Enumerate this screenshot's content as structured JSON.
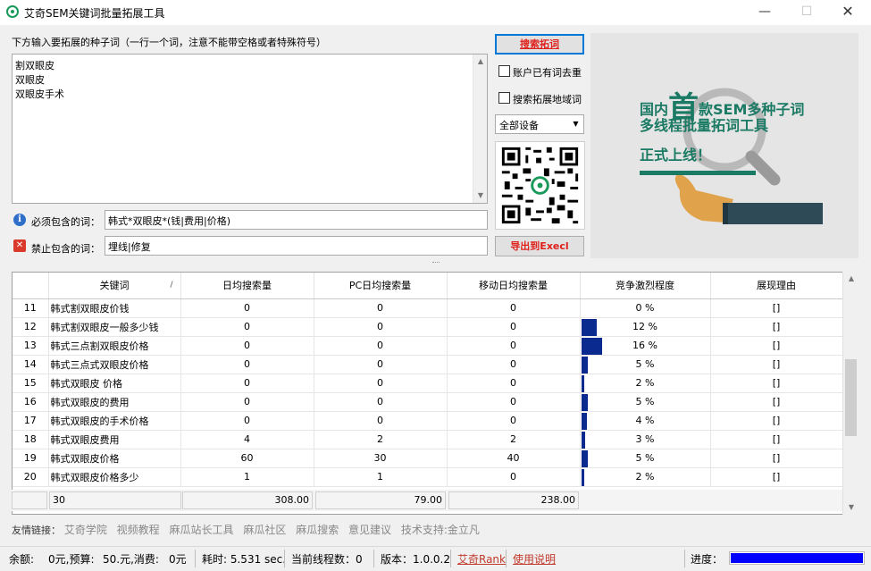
{
  "window": {
    "title": "艾奇SEM关键词批量拓展工具",
    "minimize_glyph": "—",
    "maximize_glyph": "☐",
    "close_glyph": "✕"
  },
  "seed": {
    "label": "下方输入要拓展的种子词（一行一个词，注意不能带空格或者特殊符号）",
    "lines": [
      "割双眼皮",
      "双眼皮",
      "双眼皮手术"
    ]
  },
  "filters": {
    "include_label": "必须包含的词：",
    "include_value": "韩式*双眼皮*(钱|费用|价格)",
    "exclude_label": "禁止包含的词：",
    "exclude_value": "埋线|修复"
  },
  "controls": {
    "search_button": "搜索拓词",
    "dedupe_label": "账户已有词去重",
    "region_label": "搜索拓展地域词",
    "device_select": "全部设备",
    "export_button": "导出到Execl"
  },
  "banner": {
    "line1_pre": "国内",
    "line1_big": "首",
    "line1_post": "款SEM多种子词",
    "line2": "多线程批量拓词工具",
    "line3": "正式上线！",
    "accent": "#1b7a64"
  },
  "table": {
    "headers": [
      "关键词",
      "日均搜索量",
      "PC日均搜索量",
      "移动日均搜索量",
      "竞争激烈程度",
      "展现理由"
    ],
    "sort_glyph": "/",
    "rows": [
      {
        "idx": "11",
        "keyword": "韩式割双眼皮价钱",
        "daily": "0",
        "pc": "0",
        "mobile": "0",
        "comp": 0,
        "comp_text": "0 %",
        "reason": "[]"
      },
      {
        "idx": "12",
        "keyword": "韩式割双眼皮一般多少钱",
        "daily": "0",
        "pc": "0",
        "mobile": "0",
        "comp": 12,
        "comp_text": "12 %",
        "reason": "[]"
      },
      {
        "idx": "13",
        "keyword": "韩式三点割双眼皮价格",
        "daily": "0",
        "pc": "0",
        "mobile": "0",
        "comp": 16,
        "comp_text": "16 %",
        "reason": "[]"
      },
      {
        "idx": "14",
        "keyword": "韩式三点式双眼皮价格",
        "daily": "0",
        "pc": "0",
        "mobile": "0",
        "comp": 5,
        "comp_text": "5 %",
        "reason": "[]"
      },
      {
        "idx": "15",
        "keyword": "韩式双眼皮 价格",
        "daily": "0",
        "pc": "0",
        "mobile": "0",
        "comp": 2,
        "comp_text": "2 %",
        "reason": "[]"
      },
      {
        "idx": "16",
        "keyword": "韩式双眼皮的费用",
        "daily": "0",
        "pc": "0",
        "mobile": "0",
        "comp": 5,
        "comp_text": "5 %",
        "reason": "[]"
      },
      {
        "idx": "17",
        "keyword": "韩式双眼皮的手术价格",
        "daily": "0",
        "pc": "0",
        "mobile": "0",
        "comp": 4,
        "comp_text": "4 %",
        "reason": "[]"
      },
      {
        "idx": "18",
        "keyword": "韩式双眼皮费用",
        "daily": "4",
        "pc": "2",
        "mobile": "2",
        "comp": 3,
        "comp_text": "3 %",
        "reason": "[]"
      },
      {
        "idx": "19",
        "keyword": "韩式双眼皮价格",
        "daily": "60",
        "pc": "30",
        "mobile": "40",
        "comp": 5,
        "comp_text": "5 %",
        "reason": "[]"
      },
      {
        "idx": "20",
        "keyword": "韩式双眼皮价格多少",
        "daily": "1",
        "pc": "1",
        "mobile": "0",
        "comp": 2,
        "comp_text": "2 %",
        "reason": "[]"
      }
    ],
    "footer": {
      "count": "30",
      "daily": "308.00",
      "pc": "79.00",
      "mobile": "238.00"
    },
    "bar_color": "#0a2a8f"
  },
  "links": {
    "label": "友情链接：",
    "items": [
      "艾奇学院",
      "视频教程",
      "麻瓜站长工具",
      "麻瓜社区",
      "麻瓜搜索",
      "意见建议",
      "技术支持:金立凡"
    ]
  },
  "status": {
    "balance": "余额:",
    "balance_val": "0元,预算:",
    "budget_val": "50.元,消费:",
    "spend_val": "0元",
    "time": "耗时: 5.531 sec.",
    "threads": "当前线程数：0",
    "version": "版本：1.0.0.2",
    "link_rank": "艾奇Rank",
    "link_help": "使用说明",
    "progress_label": "进度：",
    "progress_value": 1.0,
    "progress_color": "#0000ff"
  }
}
